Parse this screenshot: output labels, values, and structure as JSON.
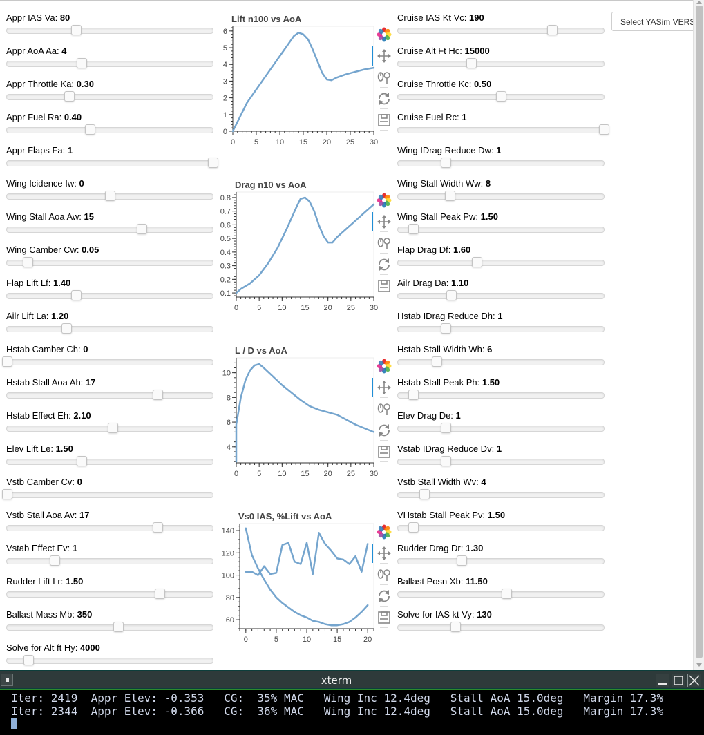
{
  "version_button": {
    "label": "Select YASim VERSION"
  },
  "sliders_left": [
    {
      "label": "Appr IAS Va:",
      "value": "80",
      "pos": 0.337
    },
    {
      "label": "Appr AoA Aa:",
      "value": "4",
      "pos": 0.363
    },
    {
      "label": "Appr Throttle Ka:",
      "value": "0.30",
      "pos": 0.303
    },
    {
      "label": "Appr Fuel Ra:",
      "value": "0.40",
      "pos": 0.403
    },
    {
      "label": "Appr Flaps Fa:",
      "value": "1",
      "pos": 1.0
    },
    {
      "label": "Wing Icidence Iw:",
      "value": "0",
      "pos": 0.5
    },
    {
      "label": "Wing Stall Aoa Aw:",
      "value": "15",
      "pos": 0.653
    },
    {
      "label": "Wing Camber Cw:",
      "value": "0.05",
      "pos": 0.1
    },
    {
      "label": "Flap Lift Lf:",
      "value": "1.40",
      "pos": 0.337
    },
    {
      "label": "Ailr Lift La:",
      "value": "1.20",
      "pos": 0.287
    },
    {
      "label": "Hstab Camber Ch:",
      "value": "0",
      "pos": 0.0
    },
    {
      "label": "Hstab Stall Aoa Ah:",
      "value": "17",
      "pos": 0.733
    },
    {
      "label": "Hstab Effect Eh:",
      "value": "2.10",
      "pos": 0.513
    },
    {
      "label": "Elev Lift Le:",
      "value": "1.50",
      "pos": 0.363
    },
    {
      "label": "Vstb Camber Cv:",
      "value": "0",
      "pos": 0.0
    },
    {
      "label": "Vstb Stall Aoa Av:",
      "value": "17",
      "pos": 0.733
    },
    {
      "label": "Vstab Effect Ev:",
      "value": "1",
      "pos": 0.233
    },
    {
      "label": "Rudder Lift Lr:",
      "value": "1.50",
      "pos": 0.74
    },
    {
      "label": "Ballast Mass Mb:",
      "value": "350",
      "pos": 0.54
    },
    {
      "label": "Solve for Alt ft Hy:",
      "value": "4000",
      "pos": 0.103
    }
  ],
  "sliders_right": [
    {
      "label": "Cruise IAS Kt Vc:",
      "value": "190",
      "pos": 0.747
    },
    {
      "label": "Cruise Alt Ft Hc:",
      "value": "15000",
      "pos": 0.357
    },
    {
      "label": "Cruise Throttle Kc:",
      "value": "0.50",
      "pos": 0.5
    },
    {
      "label": "Cruise Fuel Rc:",
      "value": "1",
      "pos": 1.0
    },
    {
      "label": "Wing IDrag Reduce Dw:",
      "value": "1",
      "pos": 0.233
    },
    {
      "label": "Wing Stall Width Ww:",
      "value": "8",
      "pos": 0.25
    },
    {
      "label": "Wing Stall Peak Pw:",
      "value": "1.50",
      "pos": 0.073
    },
    {
      "label": "Flap Drag Df:",
      "value": "1.60",
      "pos": 0.383
    },
    {
      "label": "Ailr Drag Da:",
      "value": "1.10",
      "pos": 0.257
    },
    {
      "label": "Hstab IDrag Reduce Dh:",
      "value": "1",
      "pos": 0.233
    },
    {
      "label": "Hstab Stall Width Wh:",
      "value": "6",
      "pos": 0.187
    },
    {
      "label": "Hstab Stall Peak Ph:",
      "value": "1.50",
      "pos": 0.073
    },
    {
      "label": "Elev Drag De:",
      "value": "1",
      "pos": 0.233
    },
    {
      "label": "Vstab IDrag Reduce Dv:",
      "value": "1",
      "pos": 0.233
    },
    {
      "label": "Vstb Stall Width Wv:",
      "value": "4",
      "pos": 0.127
    },
    {
      "label": "VHstab Stall Peak Pv:",
      "value": "1.50",
      "pos": 0.073
    },
    {
      "label": "Rudder Drag Dr:",
      "value": "1.30",
      "pos": 0.31
    },
    {
      "label": "Ballast Posn Xb:",
      "value": "11.50",
      "pos": 0.527
    },
    {
      "label": "Solve for IAS kt Vy:",
      "value": "130",
      "pos": 0.277
    }
  ],
  "chart_data": [
    {
      "type": "line",
      "title": "Lift n100 vs AoA",
      "xlim": [
        0,
        30
      ],
      "ylim": [
        0,
        6.2
      ],
      "xticks": [
        0,
        5,
        10,
        15,
        20,
        25,
        30
      ],
      "yticks": [
        0,
        1,
        2,
        3,
        4,
        5,
        6
      ],
      "series": [
        {
          "x": [
            -1,
            3,
            6,
            9,
            11,
            12,
            13,
            14,
            15,
            16,
            17,
            18,
            19,
            20,
            21,
            22,
            24,
            26,
            28,
            30
          ],
          "y": [
            0,
            1.7,
            2.9,
            4.1,
            4.9,
            5.3,
            5.7,
            5.9,
            5.8,
            5.5,
            4.9,
            4.2,
            3.5,
            3.1,
            3.05,
            3.2,
            3.4,
            3.55,
            3.7,
            3.8
          ]
        }
      ]
    },
    {
      "type": "line",
      "title": "Drag  n10 vs AoA",
      "xlim": [
        0,
        30
      ],
      "ylim": [
        0.07,
        0.83
      ],
      "xticks": [
        0,
        5,
        10,
        15,
        20,
        25,
        30
      ],
      "yticks": [
        0.1,
        0.2,
        0.3,
        0.4,
        0.5,
        0.6,
        0.7,
        0.8
      ],
      "yticklabels": [
        "0.1",
        "0.2",
        "0.3",
        "0.4",
        "0.5",
        "0.6",
        "0.7",
        "0.8"
      ],
      "series": [
        {
          "x": [
            -1,
            1,
            3,
            5,
            7,
            9,
            11,
            13,
            14,
            15,
            16,
            17,
            18,
            19,
            20,
            21,
            22,
            24,
            26,
            28,
            30
          ],
          "y": [
            0.1,
            0.13,
            0.17,
            0.23,
            0.32,
            0.43,
            0.57,
            0.72,
            0.79,
            0.8,
            0.77,
            0.7,
            0.6,
            0.52,
            0.47,
            0.47,
            0.51,
            0.57,
            0.63,
            0.69,
            0.75
          ]
        }
      ]
    },
    {
      "type": "line",
      "title": "L / D   vs AoA",
      "xlim": [
        0,
        30
      ],
      "ylim": [
        2.7,
        11.1
      ],
      "xticks": [
        0,
        5,
        10,
        15,
        20,
        25,
        30
      ],
      "yticks": [
        4,
        6,
        8,
        10
      ],
      "series": [
        {
          "x": [
            -1,
            0,
            1,
            2,
            3,
            4,
            5,
            6,
            8,
            10,
            12,
            14,
            16,
            18,
            20,
            22,
            24,
            26,
            28,
            30
          ],
          "y": [
            2.8,
            5.8,
            8.0,
            9.4,
            10.2,
            10.6,
            10.7,
            10.4,
            9.7,
            9.0,
            8.4,
            7.8,
            7.3,
            7.0,
            6.8,
            6.6,
            6.2,
            5.8,
            5.5,
            5.2
          ]
        }
      ]
    },
    {
      "type": "line",
      "title": "Vs0 IAS, %Lift vs AoA",
      "xlim": [
        -1,
        21
      ],
      "ylim": [
        52,
        145
      ],
      "xticks": [
        0,
        5,
        10,
        15,
        20
      ],
      "yticks": [
        60,
        80,
        100,
        120,
        140
      ],
      "series": [
        {
          "x": [
            0,
            1,
            2,
            3,
            4,
            5,
            6,
            7,
            8,
            9,
            10,
            11,
            12,
            13,
            14,
            15,
            16,
            17,
            18,
            19,
            20
          ],
          "y": [
            142,
            118,
            106,
            96,
            87,
            80,
            75,
            71,
            67,
            64,
            62,
            59,
            58,
            56,
            55,
            55,
            56,
            58,
            62,
            67,
            73
          ]
        },
        {
          "x": [
            0,
            1,
            2,
            3,
            4,
            5,
            6,
            7,
            8,
            9,
            10,
            11,
            12,
            13,
            14,
            15,
            16,
            17,
            18,
            19,
            20
          ],
          "y": [
            103,
            103,
            100,
            108,
            101,
            102,
            127,
            129,
            112,
            110,
            129,
            101,
            138,
            128,
            122,
            115,
            114,
            110,
            117,
            103,
            128
          ]
        }
      ]
    }
  ],
  "plot_tools": [
    "bokeh-logo-icon",
    "pan-icon",
    "wheel-zoom-icon",
    "reset-icon",
    "save-icon"
  ],
  "colors": {
    "line": "#75a5ce",
    "accent": "#1f8ed6",
    "terminal_bg": "#000000",
    "terminal_text": "#d0d8ea"
  },
  "xterm": {
    "title": "xterm",
    "lines": [
      "Iter: 2419  Appr Elev: -0.353   CG:  35% MAC   Wing Inc 12.4deg   Stall AoA 15.0deg   Margin 17.3%",
      "Iter: 2344  Appr Elev: -0.366   CG:  36% MAC   Wing Inc 12.4deg   Stall AoA 15.0deg   Margin 17.3%"
    ]
  }
}
